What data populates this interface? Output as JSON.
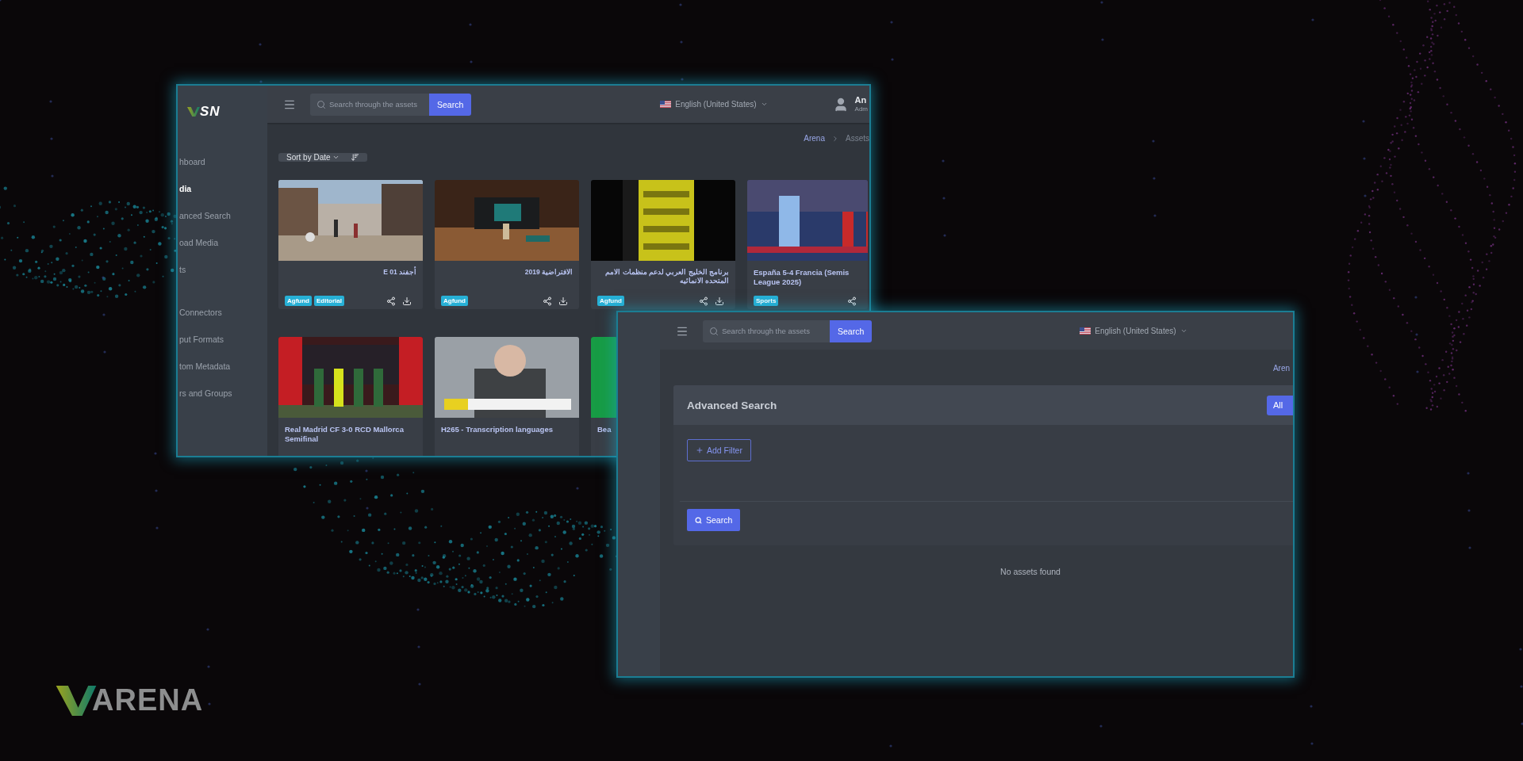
{
  "back_window": {
    "logo": {
      "text": "SN"
    },
    "sidebar": {
      "sections": [
        {
          "items": [
            {
              "label": "hboard",
              "selected": false
            },
            {
              "label": "dia",
              "selected": true
            },
            {
              "label": "anced Search",
              "selected": false
            },
            {
              "label": "oad Media",
              "selected": false
            },
            {
              "label": "ts",
              "selected": false
            }
          ]
        },
        {
          "items": [
            {
              "label": "Connectors",
              "selected": false
            },
            {
              "label": "put Formats",
              "selected": false
            },
            {
              "label": "tom Metadata",
              "selected": false
            },
            {
              "label": "rs and Groups",
              "selected": false
            }
          ]
        }
      ]
    },
    "header": {
      "search_placeholder": "Search through the assets",
      "search_button": "Search",
      "language": "English (United States)",
      "user_name": "An",
      "user_role": "Adm"
    },
    "breadcrumb": [
      "Arena",
      "Assets"
    ],
    "sort": {
      "label": "Sort by Date"
    },
    "card_rows": [
      [
        {
          "title_lines": [
            "أجفند E 01"
          ],
          "tags": [
            "Agfund",
            "Editorial"
          ],
          "share": true,
          "download": true
        },
        {
          "title_lines": [
            "الافتراضية 2019"
          ],
          "tags": [
            "Agfund"
          ],
          "share": true,
          "download": true
        },
        {
          "title_lines": [
            "برنامج الخليج العربي لدعم منظمات الامم المتحده الانمائيه"
          ],
          "tags": [
            "Agfund"
          ],
          "share": true,
          "download": true
        },
        {
          "title_lines": [
            "España 5-4 Francia (Semis",
            "League 2025)"
          ],
          "tags": [
            "Sports"
          ],
          "share": true
        }
      ],
      [
        {
          "title_lines": [
            "Real Madrid CF 3-0 RCD Mallorca",
            "Semifinal"
          ]
        },
        {
          "title_lines": [
            "H265 - Transcription languages"
          ]
        },
        {
          "title_lines": [
            "Bea"
          ]
        }
      ]
    ]
  },
  "front_window": {
    "header": {
      "search_placeholder": "Search through the assets",
      "search_button": "Search",
      "language": "English (United States)"
    },
    "breadcrumb": [
      "Aren"
    ],
    "panel": {
      "title": "Advanced Search",
      "corner_button": "All",
      "add_filter": "Add Filter",
      "search_button": "Search"
    },
    "empty_message": "No assets found"
  },
  "brand": {
    "text": "ARENA"
  }
}
